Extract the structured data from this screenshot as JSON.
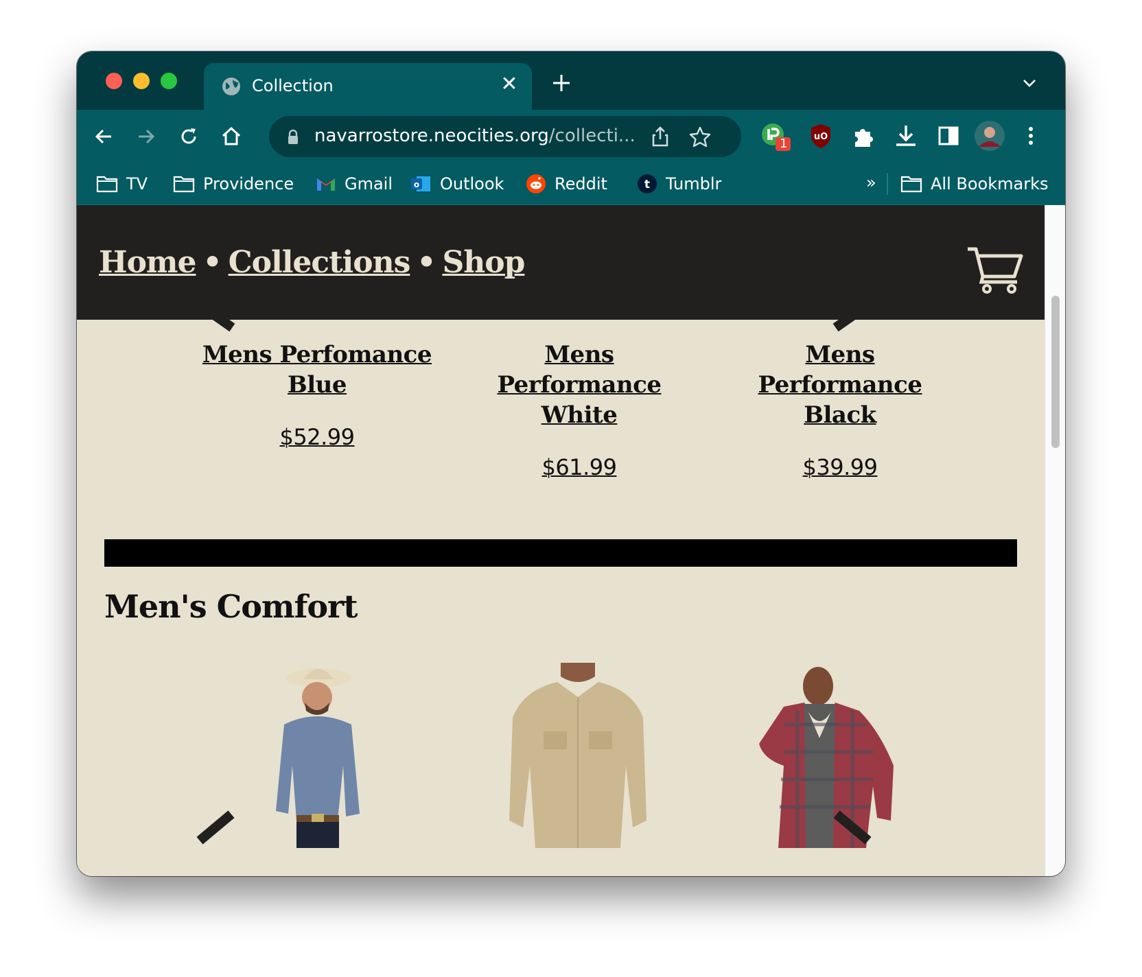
{
  "browser": {
    "tab_title": "Collection",
    "tab_close": "✕",
    "url_host": "navarrostore.neocities.org",
    "url_rest": "/collecti...",
    "extension_badge": "1",
    "bookmarks": [
      {
        "label": "TV"
      },
      {
        "label": "Providence"
      },
      {
        "label": "Gmail"
      },
      {
        "label": "Outlook"
      },
      {
        "label": "Reddit"
      },
      {
        "label": "Tumblr"
      }
    ],
    "bookmarks_more": "»",
    "all_bookmarks": "All Bookmarks"
  },
  "site": {
    "nav": [
      {
        "label": "Home"
      },
      {
        "label": "Collections"
      },
      {
        "label": "Shop"
      }
    ],
    "nav_separator": "•",
    "products": [
      {
        "name_lines": [
          "Mens Perfomance",
          "Blue"
        ],
        "price": "$52.99"
      },
      {
        "name_lines": [
          "Mens",
          "Performance",
          "White"
        ],
        "price": "$61.99"
      },
      {
        "name_lines": [
          "Mens",
          "Performance",
          "Black"
        ],
        "price": "$39.99"
      }
    ],
    "section_title": "Men's Comfort"
  }
}
